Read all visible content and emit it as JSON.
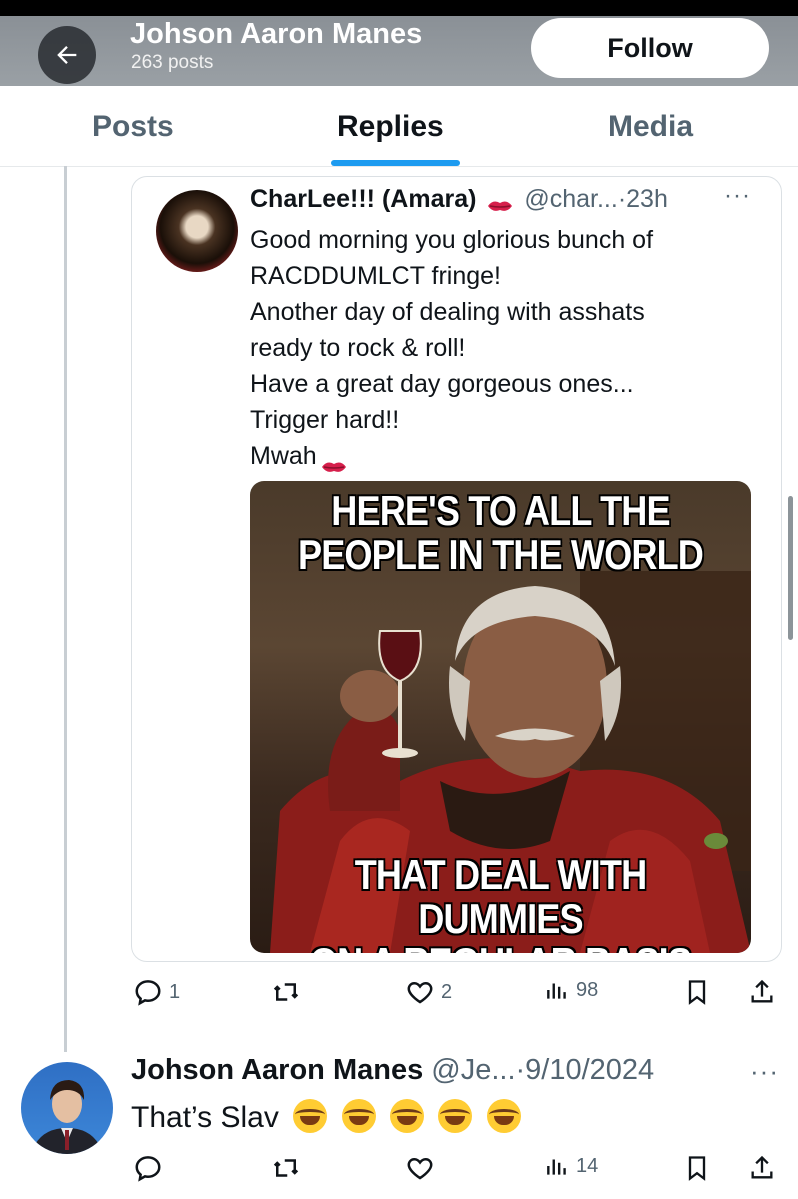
{
  "header": {
    "name": "Johson Aaron Manes",
    "post_count": "263 posts",
    "follow_label": "Follow"
  },
  "tabs": [
    {
      "label": "Posts",
      "active": false
    },
    {
      "label": "Replies",
      "active": true
    },
    {
      "label": "Media",
      "active": false
    }
  ],
  "quoted_post": {
    "author_name": "CharLee!!! (Amara)",
    "handle": "@char...",
    "time": "·23h",
    "more": "···",
    "lines": [
      "Good morning you glorious bunch of",
      "RACDDUMLCT fringe!",
      "Another day of dealing with asshats",
      "ready to rock & roll!",
      "Have a great day gorgeous ones...",
      "Trigger hard!!",
      "Mwah"
    ],
    "meme_top": [
      "HERE'S TO ALL THE",
      "PEOPLE IN THE WORLD"
    ],
    "meme_bottom": [
      "THAT DEAL WITH DUMMIES",
      "ON A REGULAR BASIS"
    ]
  },
  "quoted_actions": {
    "replies": "1",
    "likes": "2",
    "views": "98"
  },
  "reply": {
    "author_name": "Johson Aaron Manes",
    "handle": "@Je...",
    "time": "·9/10/2024",
    "more": "···",
    "text": "That’s Slav",
    "emoji_count": 5,
    "views": "14"
  },
  "colors": {
    "accent": "#1d9bf0",
    "muted": "#536471",
    "text": "#0f1419"
  },
  "icons": [
    "back-arrow-icon",
    "kiss-mark-icon",
    "reply-icon",
    "retweet-icon",
    "like-icon",
    "views-icon",
    "bookmark-icon",
    "share-icon",
    "laughing-emoji-icon"
  ]
}
